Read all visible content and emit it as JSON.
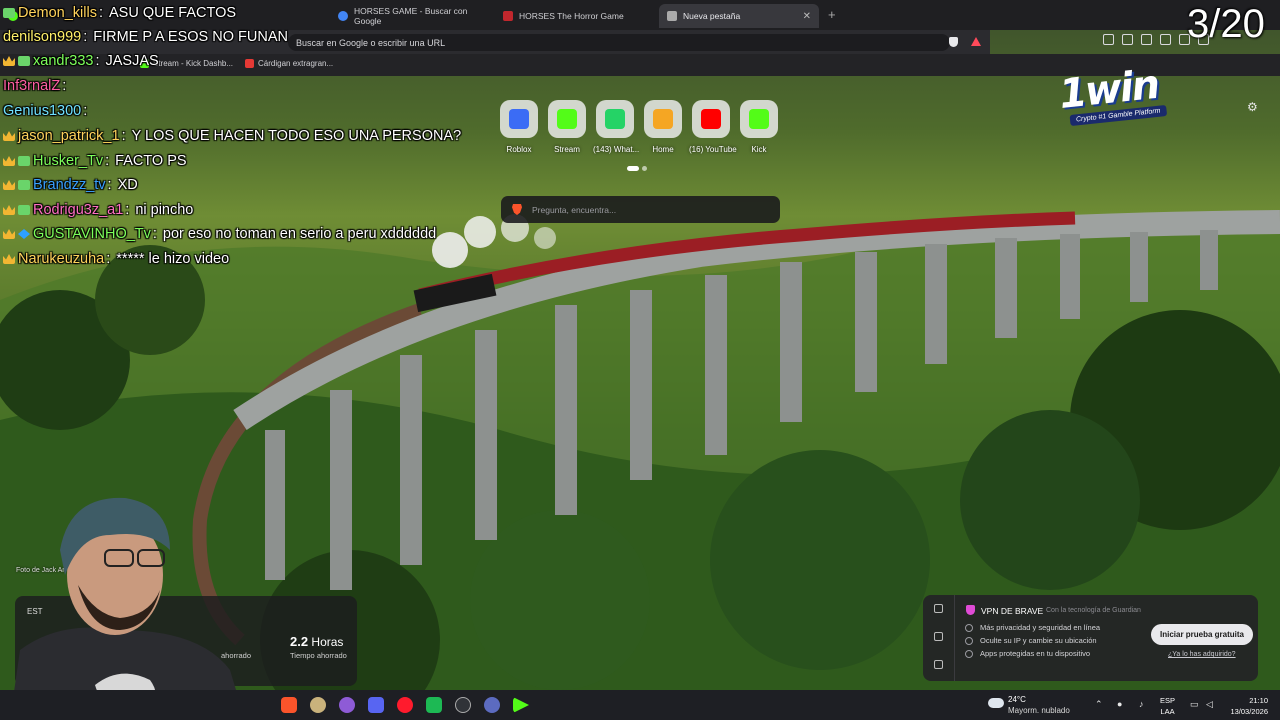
{
  "browser": {
    "tabs": [
      {
        "label": "",
        "active": false
      },
      {
        "label": "HORSES GAME - Buscar con Google",
        "active": false
      },
      {
        "label": "HORSES The Horror Game",
        "active": false
      },
      {
        "label": "Nueva pestaña",
        "active": true
      }
    ],
    "address_placeholder": "Buscar en Google o escribir una URL",
    "bookmarks": [
      "Stream - Kick Dashb...",
      "Cárdigan extragran..."
    ]
  },
  "chat": [
    {
      "user": "Demon_kills",
      "color": "#ffd35c",
      "text": "ASU QUE FACTOS",
      "badges": [
        "grid"
      ]
    },
    {
      "user": "denilson999",
      "color": "#fff06a",
      "text": "FIRME P A ESOS NO FUNAN",
      "badges": []
    },
    {
      "user": "xandr333",
      "color": "#7dff5a",
      "text": "JASJAS",
      "badges": [
        "crown",
        "grid"
      ]
    },
    {
      "user": "Inf3rnalZ",
      "color": "#ff5fa2",
      "text": "",
      "badges": []
    },
    {
      "user": "Genius1300",
      "color": "#6fe1ff",
      "text": "",
      "badges": []
    },
    {
      "user": "jason_patrick_1",
      "color": "#ffd35c",
      "text": "Y LOS QUE HACEN TODO ESO UNA PERSONA?",
      "badges": [
        "crown"
      ]
    },
    {
      "user": "Husker_Tv",
      "color": "#7dff5a",
      "text": "FACTO PS",
      "badges": [
        "crown",
        "grid"
      ]
    },
    {
      "user": "Brandzz_tv",
      "color": "#39a0ff",
      "text": "XD",
      "badges": [
        "crown",
        "grid"
      ]
    },
    {
      "user": "Rodrigu3z_a1",
      "color": "#ff6fc2",
      "text": "ni pincho",
      "badges": [
        "crown",
        "grid"
      ]
    },
    {
      "user": "GUSTAVINHO_Tv",
      "color": "#7dff5a",
      "text": "por eso no toman en serio a peru xdddddd",
      "badges": [
        "crown",
        "blue"
      ]
    },
    {
      "user": "Narukeuzuha",
      "color": "#ffd35c",
      "text": "***** le hizo video",
      "badges": [
        "crown"
      ]
    }
  ],
  "counter": "3/20",
  "brand": {
    "name": "1win",
    "tagline": "Crypto #1 Gamble Platform"
  },
  "shortcuts": [
    {
      "label": "Roblox",
      "icon": "roblox-icon",
      "color": "#3b6cf5"
    },
    {
      "label": "Stream",
      "icon": "kick-icon",
      "color": "#53fc18"
    },
    {
      "label": "(143) What...",
      "icon": "whatsapp-icon",
      "color": "#25d366"
    },
    {
      "label": "Home",
      "icon": "clapper-icon",
      "color": "#f5a623"
    },
    {
      "label": "(16) YouTube",
      "icon": "youtube-icon",
      "color": "#ff0000"
    },
    {
      "label": "Kick",
      "icon": "kick-icon",
      "color": "#53fc18"
    }
  ],
  "search_placeholder": "Pregunta, encuentra...",
  "photo_credit": "Foto de Jack An",
  "stats": {
    "label": "EST",
    "saved_label": "ahorrado",
    "time_value": "2.2",
    "time_unit": "Horas",
    "time_label": "Tiempo ahorrado"
  },
  "vpn": {
    "title": "VPN DE BRAVE",
    "powered": "Con la tecnología de Guardian",
    "features": [
      "Más privacidad y seguridad en línea",
      "Oculte su IP y cambie su ubicación",
      "Apps protegidas en tu dispositivo"
    ],
    "cta": "Iniciar prueba gratuita",
    "link": "¿Ya lo has adquirido?"
  },
  "taskbar": {
    "weather_temp": "24°C",
    "weather_cond": "Mayorm. nublado",
    "lang": "ESP",
    "region": "LAA",
    "time": "21:10",
    "date": "13/03/2026"
  },
  "colors": {
    "brave_orange": "#fb542b",
    "chrome_dark": "#1f1f22",
    "taskbar": "#1e1f24"
  }
}
